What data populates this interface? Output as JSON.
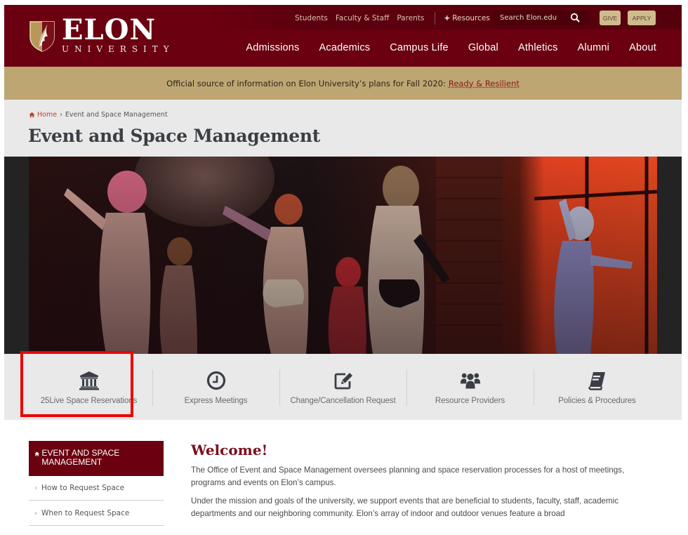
{
  "header": {
    "logo": {
      "name": "ELON",
      "subtitle": "UNIVERSITY"
    },
    "utility_links": [
      "Students",
      "Faculty & Staff",
      "Parents"
    ],
    "resources_label": "Resources",
    "search": {
      "placeholder": "Search Elon.edu"
    },
    "give_label": "GIVE",
    "apply_label": "APPLY",
    "main_nav": [
      "Admissions",
      "Academics",
      "Campus Life",
      "Global",
      "Athletics",
      "Alumni",
      "About"
    ]
  },
  "banner": {
    "text": "Official source of information on Elon University’s plans for Fall 2020:",
    "link": "Ready & Resilient"
  },
  "breadcrumb": {
    "home": "Home",
    "separator": "›",
    "current": "Event and Space Management"
  },
  "page_title": "Event and Space Management",
  "hero": {
    "image": "theatrical performance of Cats on stage"
  },
  "quick_links": [
    {
      "label": "25Live Space Reservations",
      "icon": "university-icon"
    },
    {
      "label": "Express Meetings",
      "icon": "clock-icon"
    },
    {
      "label": "Change/Cancellation Request",
      "icon": "edit-icon"
    },
    {
      "label": "Resource Providers",
      "icon": "users-icon"
    },
    {
      "label": "Policies & Procedures",
      "icon": "book-icon"
    }
  ],
  "sidebar": {
    "heading": "EVENT AND SPACE MANAGEMENT",
    "items": [
      {
        "label": "How to Request Space"
      },
      {
        "label": "When to Request Space"
      }
    ]
  },
  "content": {
    "heading": "Welcome!",
    "paragraphs": [
      "The Office of Event and Space Management oversees planning and space reservation processes for a host of meetings, programs and events on Elon’s campus.",
      "Under the mission and goals of the university, we support events that are beneficial to students, faculty, staff, academic departments and our neighboring community. Elon’s array of indoor and outdoor venues feature a broad"
    ]
  },
  "colors": {
    "maroon": "#6a0010",
    "gold": "#bea673",
    "button_gold": "#cfbc8d",
    "light_gray": "#e9e9e9",
    "highlight_red": "#ee0000"
  }
}
